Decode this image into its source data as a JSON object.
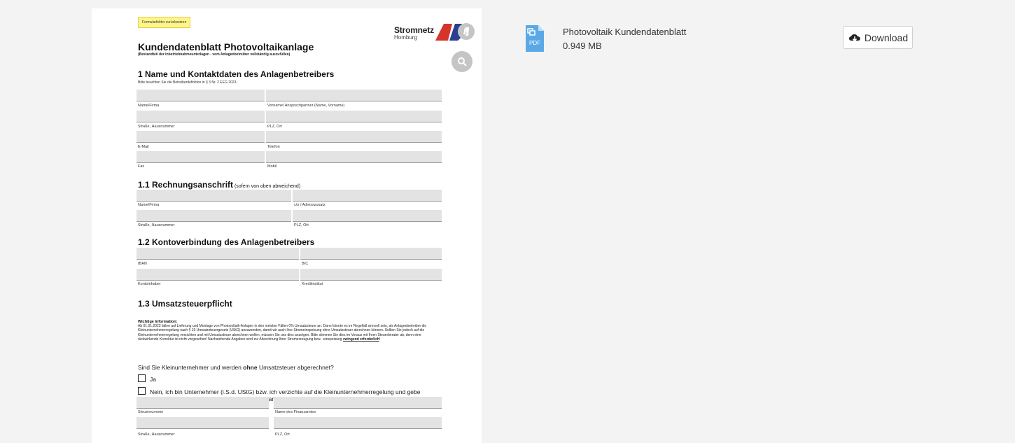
{
  "preview": {
    "reset_label": "Formularfelder zurücksetzen",
    "logo_title": "Stromnetz",
    "logo_sub": "Homburg",
    "title": "Kundendatenblatt Photovoltaikanlage",
    "subtitle": "(Bestandteil der Inbetriebnahmeunterlagen - vom Anlagenbetreiber vollständig auszufüllen)",
    "section1": {
      "heading": "1    Name und Kontaktdaten des Anlagenbetreibers",
      "hint": "Bitte beachten Sie die Betreiberdefinition in § 3 Nr. 2 EEG 2023.",
      "labels": [
        "Name/Firma",
        "Vorname/ Ansprechpartner (Name, Vorname)",
        "Straße, Hausnummer",
        "PLZ, Ort",
        "E-Mail",
        "Telefon",
        "Fax",
        "Mobil"
      ]
    },
    "section11": {
      "heading": "1.1 Rechnungsanschrift",
      "note": " (sofern von oben abweichend)",
      "labels": [
        "Name/Firma",
        "c/o / Adresszusatz",
        "Straße, Hausnummer",
        "PLZ, Ort"
      ]
    },
    "section12": {
      "heading": "1.2 Kontoverbindung des Anlagenbetreibers",
      "labels": [
        "IBAN",
        "BIC",
        "Kontoinhaber",
        "Kreditinstitut"
      ]
    },
    "section13": {
      "heading": "1.3 Umsatzsteuerpflicht",
      "info_title": "Wichtige Information:",
      "info_text": "Ab 01.01.2023 fallen auf Lieferung und Montage von Photovoltaik-Anlagen in den meisten Fällen 0% Umsatzsteuer an. Dann könnte es im Regelfall sinnvoll sein, als Anlagenbetreiber die Kleinunternehmerregelung nach § 19 Umsatzsteuergesetz (UStG) anzuwenden, damit wir auch Ihre Stromeinspeisung ohne Umsatzsteuer abrechnen können. Sollten Sie jedoch auf die Kleinunternehmerregelung verzichten und mit Umsatzsteuer abrechnen wollen, müssen Sie uns dies anzeigen. Bitte stimmen Sie dies im Voraus mit Ihren Steuerberater ab, denn eine rückwirkende Korrektur ist nicht vorgesehen! Nachstehende Angaben sind zur Abrechnung Ihrer Stromerzeugung bzw. -einspeisung ",
      "info_emph": "zwingend erforderlich",
      "info_end": "!",
      "question_a": "Sind Sie Kleinunternehmer und werden ",
      "question_b": "ohne",
      "question_c": " Umsatzsteuer abgerechnet?",
      "option_yes": "Ja",
      "option_no": "Nein, ich bin Unternehmer (i.S.d. UStG) bzw. ich verzichte auf die Kleinunternehmerregelung und gebe meine Steuererklärung bei folgendem Finanzamt ab:",
      "labels": [
        "Steuernummer",
        "Name des Finanzamtes",
        "Straße, Hausnummer",
        "PLZ, Ort"
      ]
    }
  },
  "file": {
    "icon": "pdf-file-icon",
    "name": "Photovoltaik Kundendatenblatt",
    "size": "0.949 MB",
    "download_label": "Download",
    "download_icon": "cloud-download-icon"
  },
  "colors": {
    "accent_blue": "#5aa9e6",
    "logo_red": "#d6342a",
    "logo_navy": "#2b3e8f",
    "reset_yellow": "#fff58a"
  }
}
